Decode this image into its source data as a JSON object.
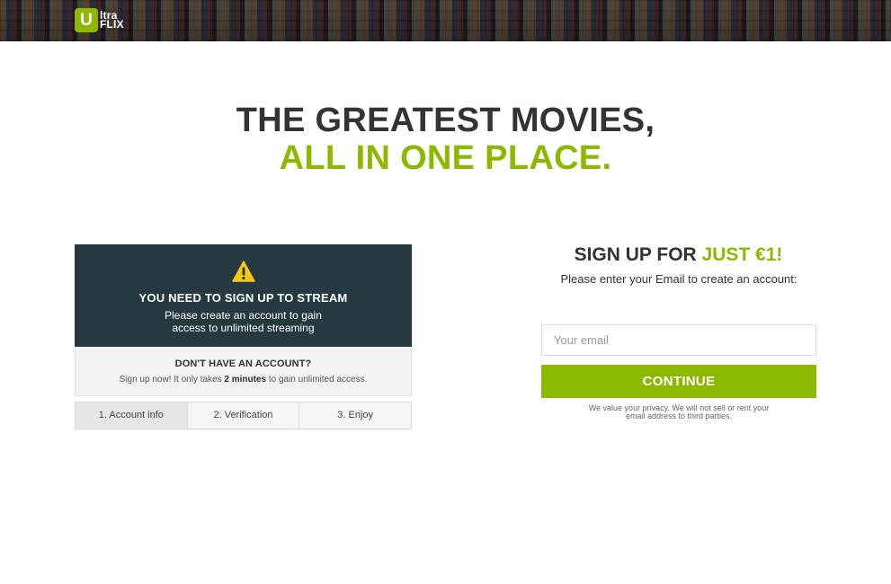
{
  "brand": {
    "logo_letter": "U",
    "logo_line1": "ltra",
    "logo_line2": "FLIX",
    "accent": "#8cb900"
  },
  "hero": {
    "line1": "THE GREATEST MOVIES,",
    "line2": "ALL IN ONE PLACE."
  },
  "alert": {
    "icon": "warning-icon",
    "title": "YOU NEED TO SIGN UP TO STREAM",
    "subtitle": "Please create an account to gain access to unlimited streaming",
    "bg_color": "#263840"
  },
  "account": {
    "title": "DON'T HAVE AN ACCOUNT?",
    "sub_before": "Sign up now! It only takes ",
    "sub_bold": "2 minutes",
    "sub_after": " to gain unlimited access."
  },
  "steps": [
    {
      "label": "1. Account info",
      "active": true
    },
    {
      "label": "2. Verification",
      "active": false
    },
    {
      "label": "3. Enjoy",
      "active": false
    }
  ],
  "signup": {
    "title_prefix": "SIGN UP FOR ",
    "title_price": "JUST €1!",
    "subtitle": "Please enter your Email to create an account:",
    "email_placeholder": "Your email",
    "email_value": "",
    "continue_label": "CONTINUE",
    "privacy": "We value your privacy. We will not sell or rent your email address to third parties."
  }
}
